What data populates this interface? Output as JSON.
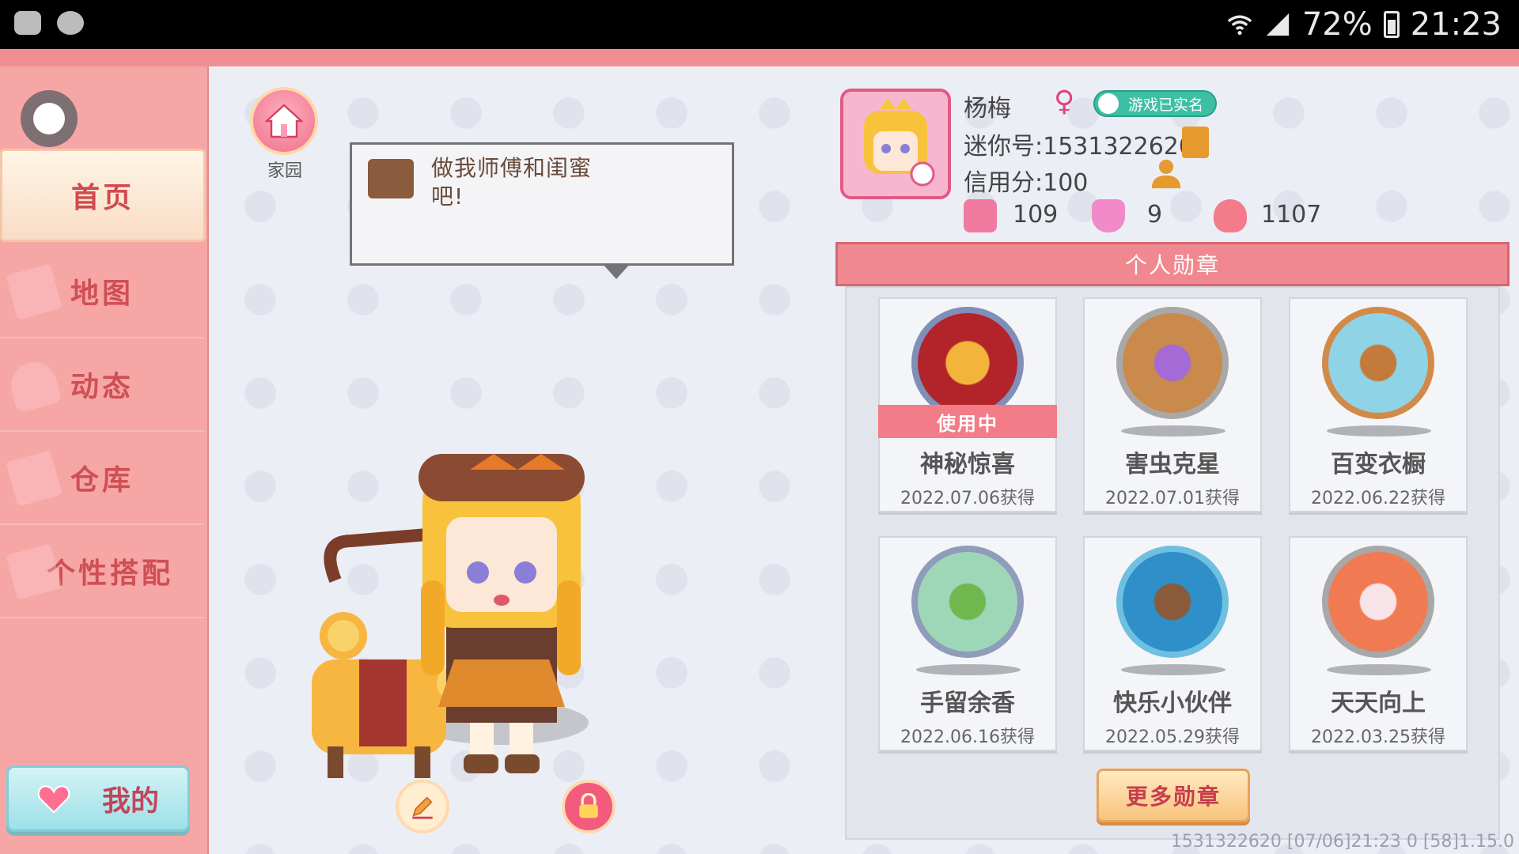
{
  "status_bar": {
    "battery": "72%",
    "time": "21:23"
  },
  "sidebar": {
    "items": [
      {
        "label": "首页",
        "active": true
      },
      {
        "label": "地图",
        "active": false
      },
      {
        "label": "动态",
        "active": false
      },
      {
        "label": "仓库",
        "active": false
      },
      {
        "label": "个性搭配",
        "active": false
      }
    ],
    "mine_label": "我的"
  },
  "home": {
    "label": "家园"
  },
  "speech_bubble": {
    "text": "做我师傅和闺蜜吧!"
  },
  "profile": {
    "name": "杨梅",
    "gender_symbol": "♀",
    "verified_badge": "游戏已实名",
    "mini_id": "迷你号:1531322620",
    "credit": "信用分:100",
    "stats": [
      {
        "icon": "book-plus-icon",
        "value": "109"
      },
      {
        "icon": "trophy-icon",
        "value": "9"
      },
      {
        "icon": "flame-icon",
        "value": "1107"
      }
    ]
  },
  "medals": {
    "header": "个人勋章",
    "in_use_label": "使用中",
    "items": [
      {
        "name": "神秘惊喜",
        "date": "2022.07.06获得",
        "in_use": true,
        "ring_color": "#7f8fb8",
        "fill_color": "#b2242a"
      },
      {
        "name": "害虫克星",
        "date": "2022.07.01获得",
        "in_use": false,
        "ring_color": "#a8a8a8",
        "fill_color": "#c98a4b"
      },
      {
        "name": "百变衣橱",
        "date": "2022.06.22获得",
        "in_use": false,
        "ring_color": "#d28a47",
        "fill_color": "#8fd3e6"
      },
      {
        "name": "手留余香",
        "date": "2022.06.16获得",
        "in_use": false,
        "ring_color": "#8f9cba",
        "fill_color": "#9ed7b8"
      },
      {
        "name": "快乐小伙伴",
        "date": "2022.05.29获得",
        "in_use": false,
        "ring_color": "#6fbfe0",
        "fill_color": "#2e8fc9"
      },
      {
        "name": "天天向上",
        "date": "2022.03.25获得",
        "in_use": false,
        "ring_color": "#a8a8a8",
        "fill_color": "#f07b52"
      }
    ],
    "more_button": "更多勋章"
  },
  "footer": {
    "info": "1531322620   [07/06]21:23 0   [58]1.15.0"
  }
}
